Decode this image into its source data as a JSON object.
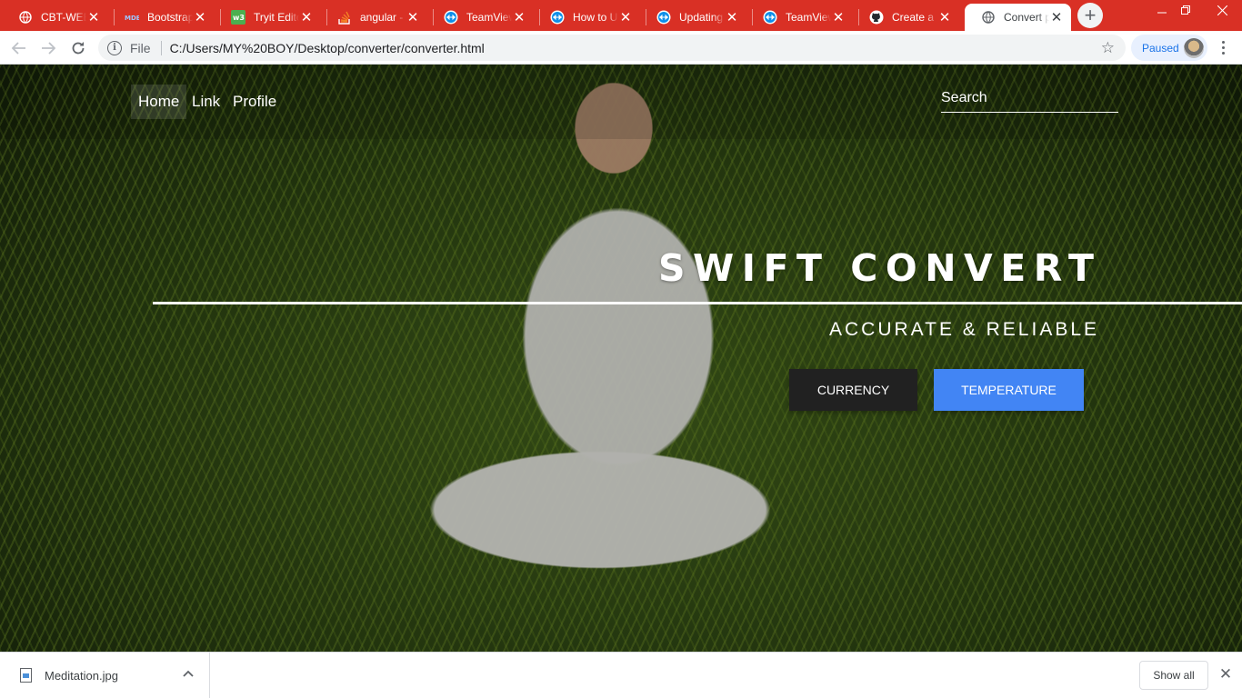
{
  "browser": {
    "tabs": [
      {
        "title": "CBT-WEB",
        "favicon": "globe-icon"
      },
      {
        "title": "Bootstrap",
        "favicon": "mdb-icon"
      },
      {
        "title": "Tryit Editor",
        "favicon": "w3schools-icon"
      },
      {
        "title": "angular -",
        "favicon": "stackoverflow-icon"
      },
      {
        "title": "TeamViewer",
        "favicon": "teamviewer-icon"
      },
      {
        "title": "How to U",
        "favicon": "teamviewer-icon"
      },
      {
        "title": "Updating",
        "favicon": "teamviewer-icon"
      },
      {
        "title": "TeamViewer",
        "favicon": "teamviewer-icon"
      },
      {
        "title": "Create a",
        "favicon": "github-icon"
      },
      {
        "title": "Convert p",
        "favicon": "globe-icon",
        "active": true
      }
    ],
    "new_tab_symbol": "+",
    "omnibox": {
      "scheme_label": "File",
      "url": "C:/Users/MY%20BOY/Desktop/converter/converter.html"
    },
    "profile_status": "Paused"
  },
  "page": {
    "nav": {
      "links": [
        {
          "label": "Home",
          "active": true
        },
        {
          "label": "Link"
        },
        {
          "label": "Profile"
        }
      ],
      "search_placeholder": "Search"
    },
    "hero": {
      "title": "SWIFT CONVERT",
      "subtitle": "ACCURATE & RELIABLE",
      "buttons": {
        "currency": "CURRENCY",
        "temperature": "TEMPERATURE"
      }
    }
  },
  "downloads": {
    "file_name": "Meditation.jpg",
    "show_all_label": "Show all"
  },
  "colors": {
    "tabstrip": "#d93025",
    "button_dark": "#212121",
    "button_primary": "#4285f4"
  }
}
